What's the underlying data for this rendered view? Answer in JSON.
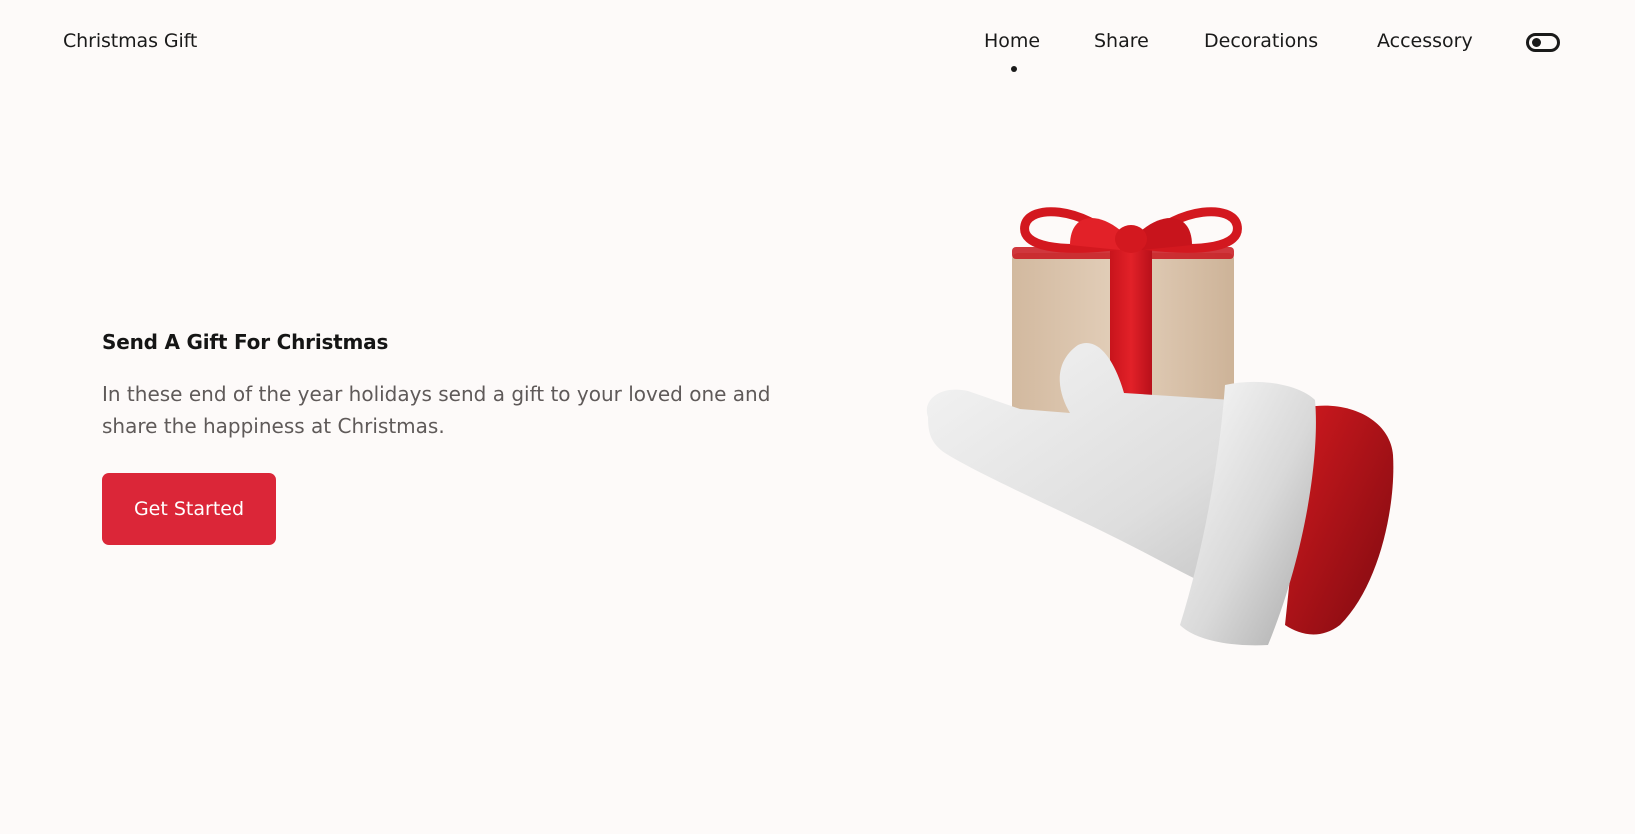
{
  "header": {
    "logo": "Christmas Gift",
    "nav": [
      {
        "label": "Home",
        "active": true
      },
      {
        "label": "Share",
        "active": false
      },
      {
        "label": "Decorations",
        "active": false
      },
      {
        "label": "Accessory",
        "active": false
      }
    ],
    "theme_toggle_icon": "toggle-icon"
  },
  "hero": {
    "title": "Send A Gift For Christmas",
    "description": "In these end of the year holidays send a gift to your loved one and share the happiness at Christmas.",
    "button_label": "Get Started",
    "illustration_icon": "santa-hand-gift-illustration"
  },
  "colors": {
    "background": "#fdfaf9",
    "accent": "#db2638",
    "text": "#171717",
    "muted_text": "#5f5a59"
  }
}
